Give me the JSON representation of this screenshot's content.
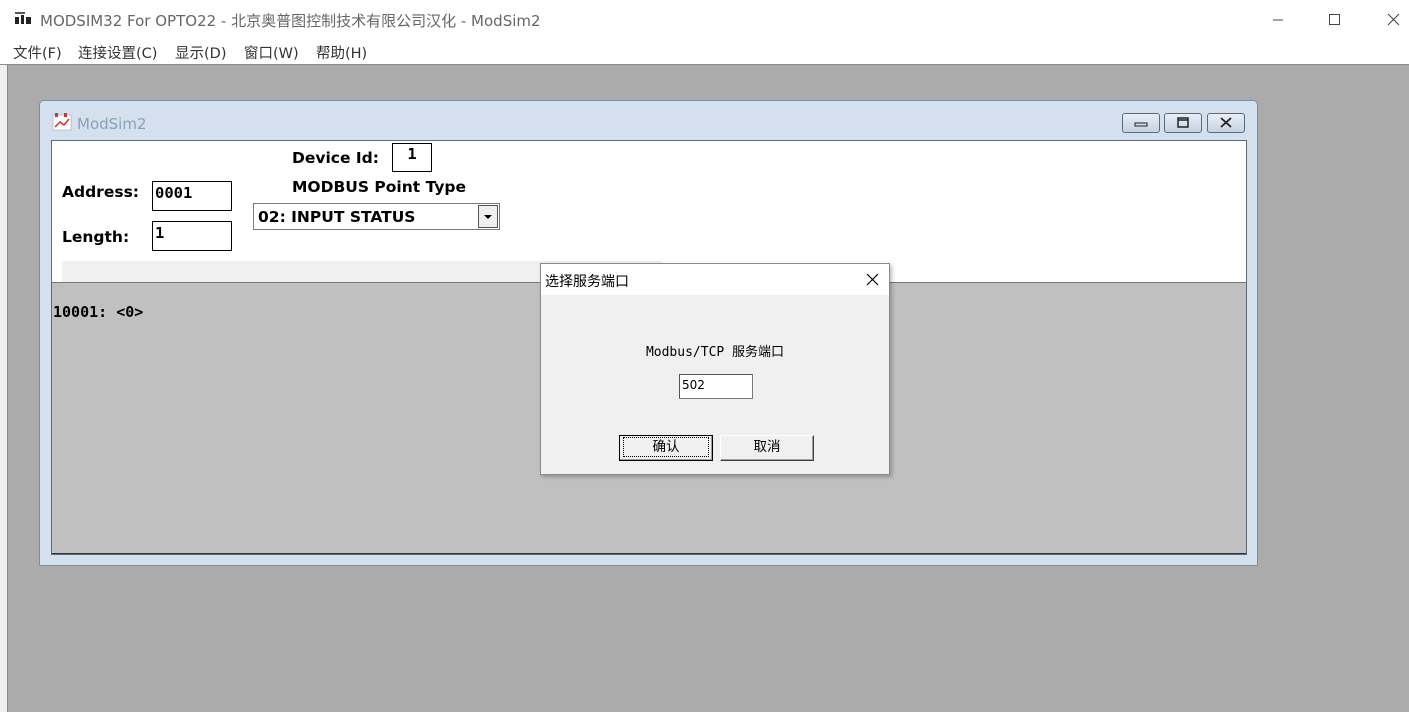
{
  "window": {
    "title": "MODSIM32 For OPTO22 - 北京奥普图控制技术有限公司汉化 - ModSim2",
    "logo_icon": "app-logo-icon"
  },
  "menu": {
    "items": [
      {
        "label": "文件(F)"
      },
      {
        "label": "连接设置(C)"
      },
      {
        "label": "显示(D)"
      },
      {
        "label": "窗口(W)"
      },
      {
        "label": "帮助(H)"
      }
    ]
  },
  "child_window": {
    "title": "ModSim2",
    "device_id_label": "Device Id:",
    "device_id_value": "1",
    "address_label": "Address:",
    "address_value": "0001",
    "length_label": "Length:",
    "length_value": "1",
    "point_type_label": "MODBUS Point Type",
    "point_type_value": "02: INPUT STATUS",
    "register_line": "10001: <0>"
  },
  "dialog": {
    "title": "选择服务端口",
    "label": "Modbus/TCP 服务端口",
    "port_value": "502",
    "ok_label": "确认",
    "cancel_label": "取消"
  },
  "colors": {
    "desktop": "#ababab",
    "child_frame": "#d4e0ee",
    "data_area": "#c0c0c0"
  }
}
